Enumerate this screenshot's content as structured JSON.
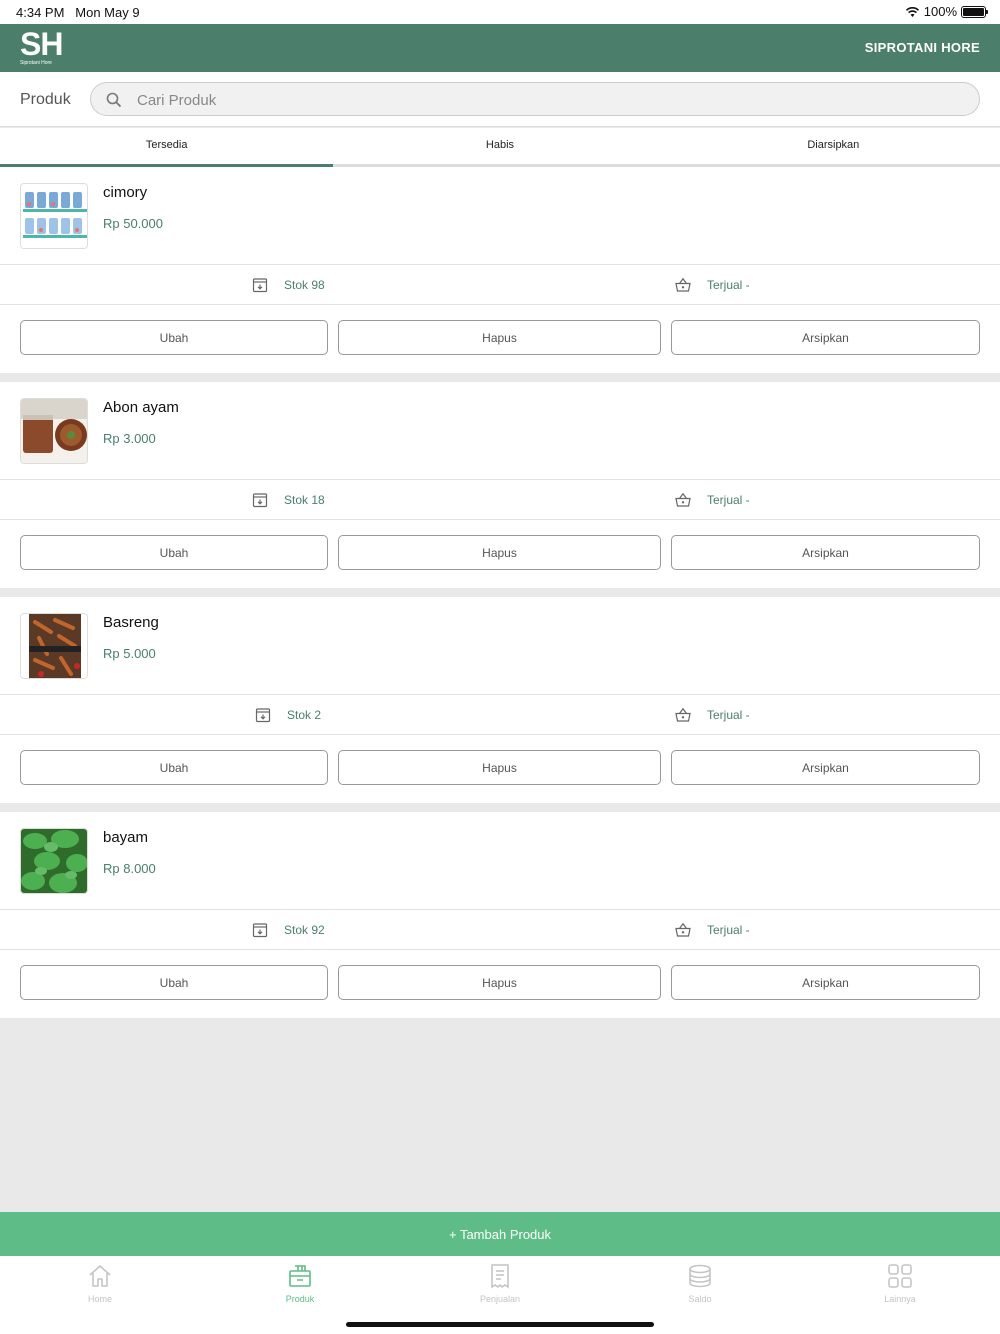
{
  "status_bar": {
    "time": "4:34 PM",
    "date": "Mon May 9",
    "battery": "100%"
  },
  "app_bar": {
    "logo_text": "SH",
    "logo_subtext": "Siprotani Hore",
    "brand": "SIPROTANI HORE",
    "color": "#4b7f6b"
  },
  "search": {
    "label": "Produk",
    "placeholder": "Cari Produk"
  },
  "tabs": [
    {
      "label": "Tersedia",
      "active": true
    },
    {
      "label": "Habis"
    },
    {
      "label": "Diarsipkan"
    }
  ],
  "products": [
    {
      "name": "cimory",
      "price": "Rp 50.000",
      "stock": "Stok 98",
      "sold": "Terjual -",
      "edit": "Ubah",
      "delete": "Hapus",
      "archive": "Arsipkan"
    },
    {
      "name": "Abon ayam",
      "price": "Rp 3.000",
      "stock": "Stok 18",
      "sold": "Terjual -",
      "edit": "Ubah",
      "delete": "Hapus",
      "archive": "Arsipkan"
    },
    {
      "name": "Basreng",
      "price": "Rp 5.000",
      "stock": "Stok 2",
      "sold": "Terjual -",
      "edit": "Ubah",
      "delete": "Hapus",
      "archive": "Arsipkan"
    },
    {
      "name": "bayam",
      "price": "Rp 8.000",
      "stock": "Stok 92",
      "sold": "Terjual -",
      "edit": "Ubah",
      "delete": "Hapus",
      "archive": "Arsipkan"
    }
  ],
  "add_button": {
    "label": "+ Tambah Produk",
    "color": "#5ebc87"
  },
  "bottom_nav": [
    {
      "label": "Home",
      "icon": "home-icon"
    },
    {
      "label": "Produk",
      "icon": "product-box-icon",
      "active": true
    },
    {
      "label": "Penjualan",
      "icon": "receipt-icon"
    },
    {
      "label": "Saldo",
      "icon": "coins-icon"
    },
    {
      "label": "Lainnya",
      "icon": "grid-icon"
    }
  ]
}
